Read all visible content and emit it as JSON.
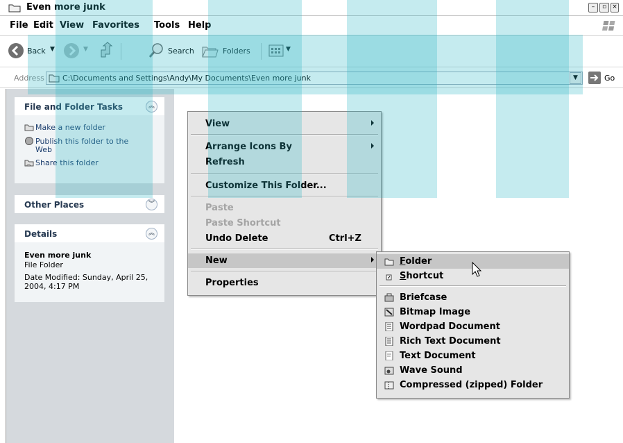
{
  "window": {
    "title": "Even more junk"
  },
  "menubar": {
    "items": [
      "File",
      "Edit",
      "View",
      "Favorites",
      "Tools",
      "Help"
    ]
  },
  "toolbar": {
    "back": "Back",
    "search": "Search",
    "folders": "Folders"
  },
  "address": {
    "label": "Address",
    "path": "C:\\Documents and Settings\\Andy\\My Documents\\Even more junk",
    "go": "Go"
  },
  "tasks": {
    "title": "File and Folder Tasks",
    "items": [
      "Make a new folder",
      "Publish this folder to the",
      "Web",
      "Share this folder"
    ]
  },
  "other_places": {
    "title": "Other Places"
  },
  "details": {
    "title": "Details",
    "name": "Even more junk",
    "type": "File Folder",
    "modified_line1": "Date Modified: Sunday, April 25,",
    "modified_line2": "2004, 4:17 PM"
  },
  "context_menu": {
    "view": "View",
    "arrange": "Arrange Icons By",
    "refresh": "Refresh",
    "customize": "Customize This Folder...",
    "paste": "Paste",
    "paste_shortcut": "Paste Shortcut",
    "undo_delete": "Undo Delete",
    "undo_shortcut": "Ctrl+Z",
    "new": "New",
    "properties": "Properties"
  },
  "new_menu": {
    "folder_u": "F",
    "folder_rest": "older",
    "shortcut_u": "S",
    "shortcut_rest": "hortcut",
    "items": [
      "Briefcase",
      "Bitmap Image",
      "Wordpad Document",
      "Rich Text Document",
      "Text Document",
      "Wave Sound",
      "Compressed (zipped) Folder"
    ]
  },
  "colors": {
    "watermark": "#2eb6c4",
    "panel_bg": "#d5d9dd",
    "menu_bg": "#e6e6e6",
    "highlight": "#c6c6c6"
  }
}
